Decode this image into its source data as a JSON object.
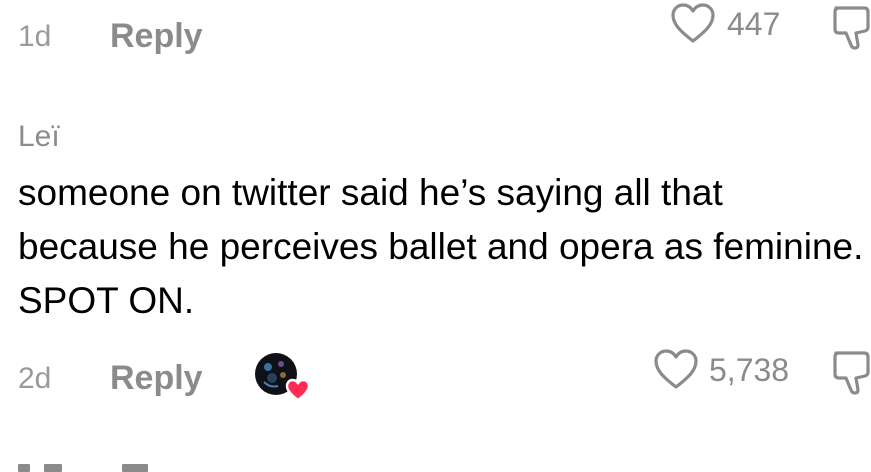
{
  "top_comment": {
    "time": "1d",
    "reply_label": "Reply",
    "like_count": "447"
  },
  "comment": {
    "author": "Leï",
    "text": "someone on twitter said he’s saying all that because he perceives ballet and opera as feminine. SPOT ON.",
    "time": "2d",
    "reply_label": "Reply",
    "like_count": "5,738",
    "creator_liked": true
  },
  "icons": {
    "like": "heart-outline-icon",
    "dislike": "thumbs-down-icon",
    "creator_like_badge": "heart-filled-icon"
  },
  "colors": {
    "secondary_text": "#8b8b8b",
    "time_text": "#9a9a9a",
    "heart_badge": "#fe2c55"
  }
}
